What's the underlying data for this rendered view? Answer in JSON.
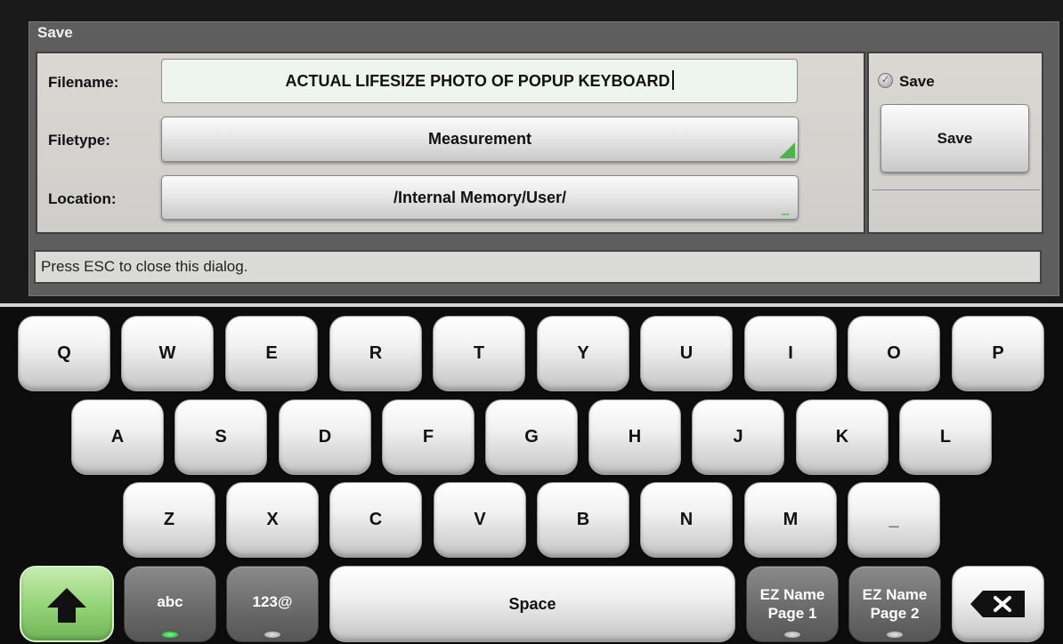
{
  "dialog": {
    "title": "Save",
    "filename_label": "Filename:",
    "filename_value": "ACTUAL LIFESIZE PHOTO OF POPUP KEYBOARD",
    "filetype_label": "Filetype:",
    "filetype_value": "Measurement",
    "location_label": "Location:",
    "location_value": "/Internal Memory/User/",
    "location_indicator": "...",
    "save_checkbox_label": "Save",
    "save_checkbox_checked": true,
    "save_button_label": "Save",
    "status_text": "Press ESC to close this dialog."
  },
  "keyboard": {
    "row1": [
      "Q",
      "W",
      "E",
      "R",
      "T",
      "Y",
      "U",
      "I",
      "O",
      "P"
    ],
    "row2": [
      "A",
      "S",
      "D",
      "F",
      "G",
      "H",
      "J",
      "K",
      "L"
    ],
    "row3": [
      "Z",
      "X",
      "C",
      "V",
      "B",
      "N",
      "M",
      "_"
    ],
    "abc_label": "abc",
    "num_label": "123@",
    "space_label": "Space",
    "ez1_line1": "EZ Name",
    "ez1_line2": "Page 1",
    "ez2_line1": "EZ Name",
    "ez2_line2": "Page 2",
    "shift_icon": "shift-arrow-icon",
    "backspace_icon": "backspace-icon"
  },
  "colors": {
    "shift_active": "#86c766",
    "led_on": "#22c23a",
    "dialog_frame": "#5e5e5e",
    "filename_bg": "#eef5ef"
  }
}
